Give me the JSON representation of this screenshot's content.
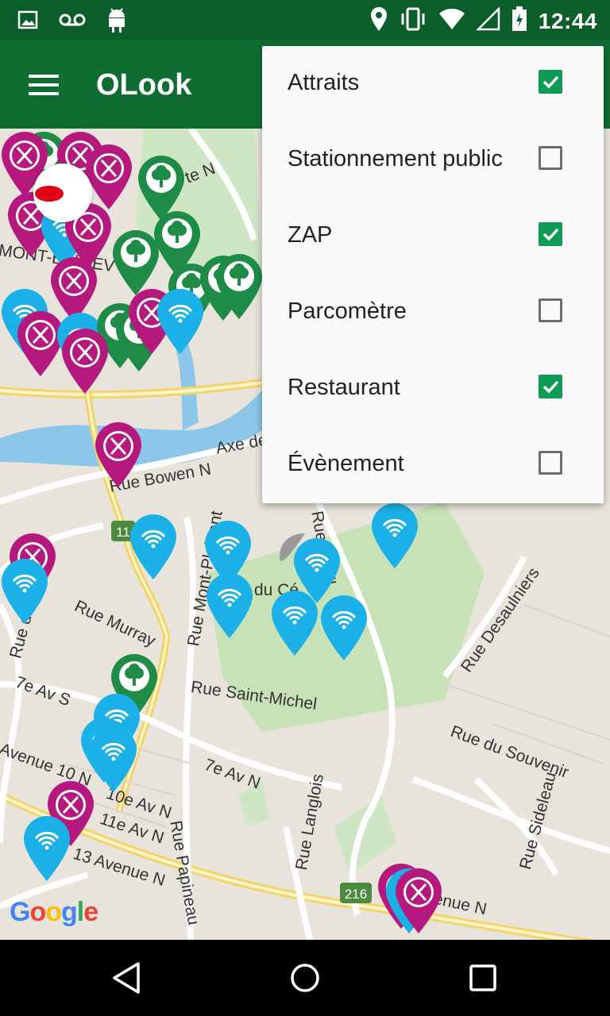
{
  "status_bar": {
    "time": "12:44",
    "left_icons": [
      "image-icon",
      "voicemail-icon",
      "android-icon"
    ],
    "right_icons": [
      "location-icon",
      "vibrate-icon",
      "wifi-icon",
      "signal-icon",
      "battery-icon"
    ]
  },
  "app_bar": {
    "title": "OLook",
    "menu_icon": "hamburger-icon",
    "color": "#106d32"
  },
  "filter_menu": {
    "items": [
      {
        "label": "Attraits",
        "checked": true
      },
      {
        "label": "Stationnement public",
        "checked": false
      },
      {
        "label": "ZAP",
        "checked": true
      },
      {
        "label": "Parcomètre",
        "checked": false
      },
      {
        "label": "Restaurant",
        "checked": true
      },
      {
        "label": "Évènement",
        "checked": false
      }
    ],
    "check_color": "#0f9b54"
  },
  "map": {
    "attribution": "Google",
    "street_labels": [
      "Axe de",
      "Rue Bowen N",
      "Rue Murray",
      "Rue Mont-Plaisant",
      "du Cé",
      "Rue Terrill",
      "Rue Desaulniers",
      "Rue Saint-Michel",
      "7e Av S",
      "Rue du Souvenir",
      "Rue Papineau",
      "7e Av N",
      "Avenue 10 N",
      "10e Av N",
      "11e Av N",
      "13 Avenue N",
      "Rue Langlois",
      "Rue Sideleau",
      "216",
      "11",
      "Rue du Co",
      "Venue N",
      "MONT-BELLEV",
      "te N"
    ],
    "pin_colors": {
      "restaurant": "#b5197e",
      "zap": "#1bb0e8",
      "attrait": "#1e8c47"
    }
  },
  "nav_bar": {
    "buttons": [
      "back-icon",
      "home-icon",
      "recents-icon"
    ]
  }
}
